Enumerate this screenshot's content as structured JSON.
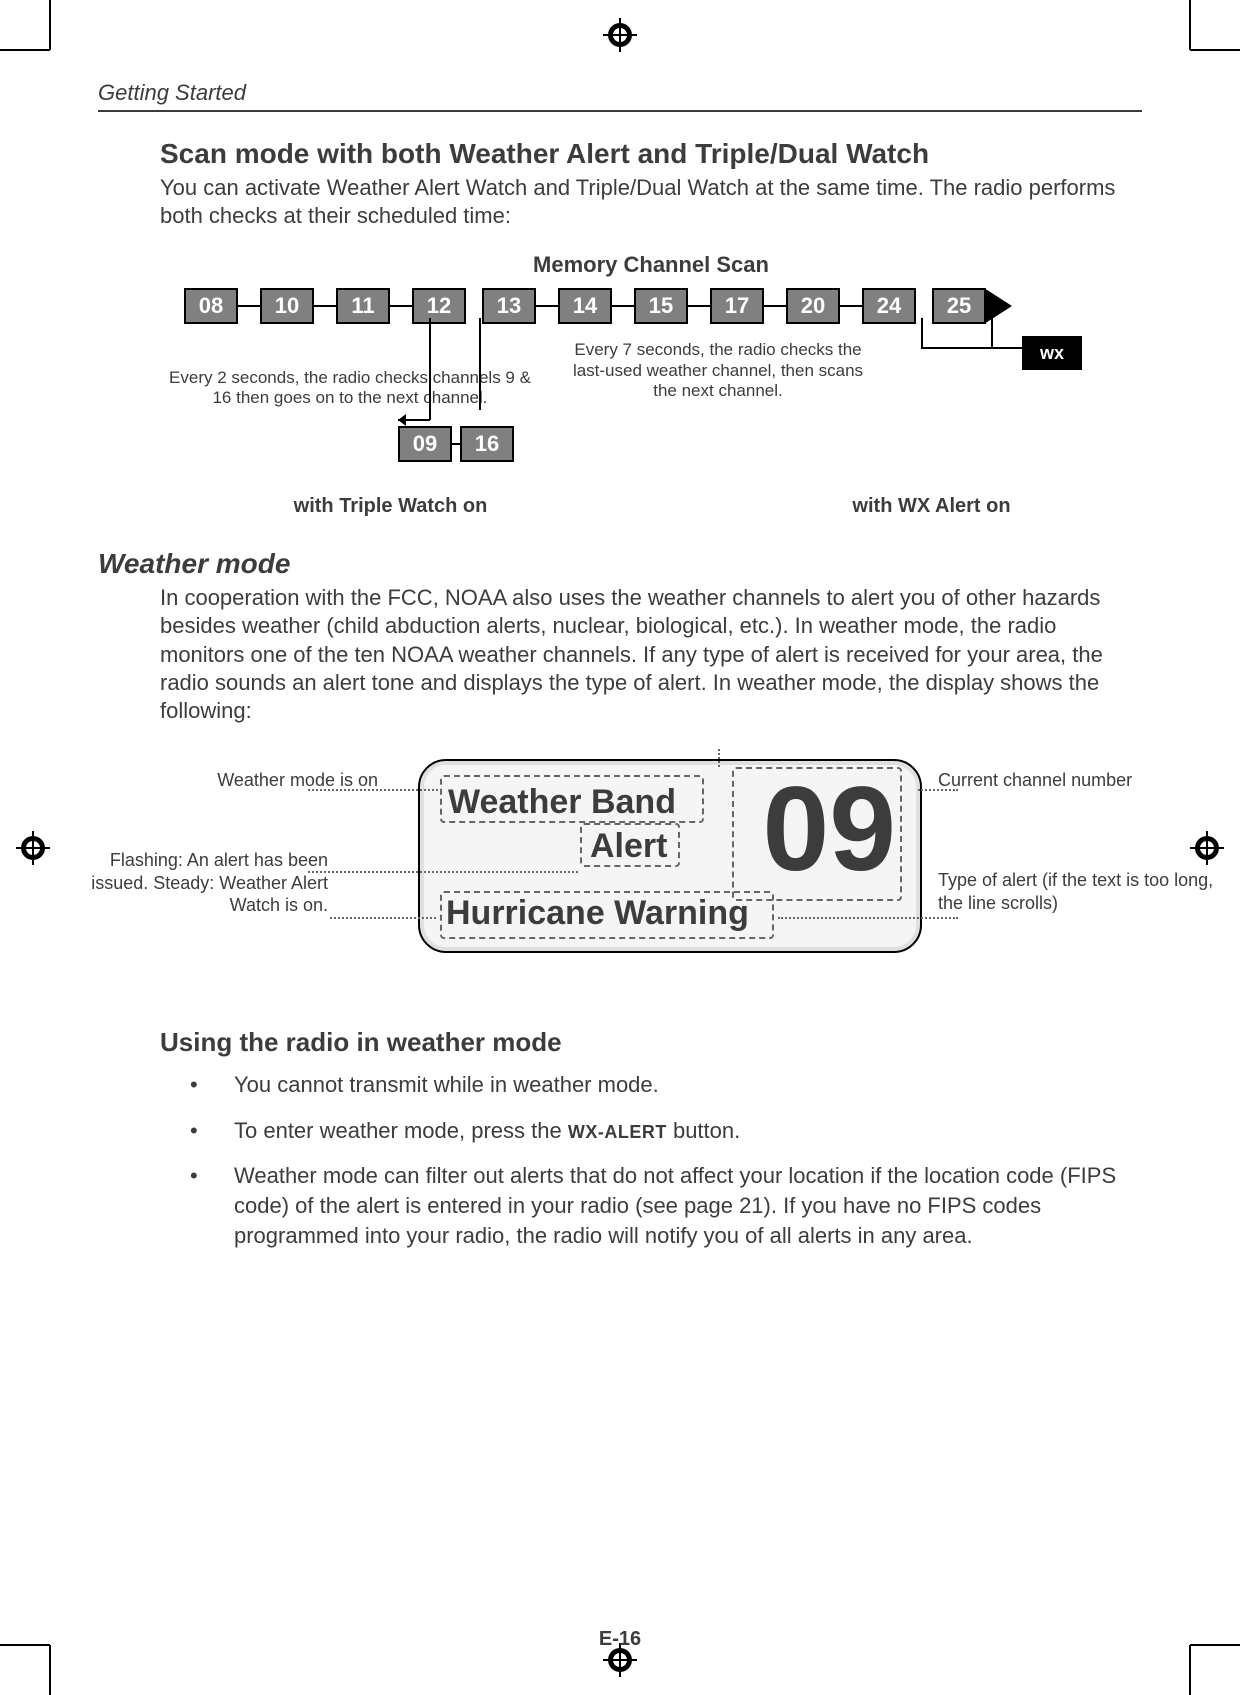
{
  "running_head": "Getting Started",
  "section1_title": "Scan mode with both Weather Alert and Triple/Dual Watch",
  "section1_body": "You can activate Weather Alert Watch and Triple/Dual Watch at the same time. The radio performs both checks at their scheduled time:",
  "diagram": {
    "title": "Memory Channel Scan",
    "channels": [
      "08",
      "10",
      "11",
      "12",
      "13",
      "14",
      "15",
      "17",
      "20",
      "24",
      "25"
    ],
    "pair": [
      "09",
      "16"
    ],
    "wx": "wx",
    "left_desc": "Every 2 seconds, the radio checks channels 9 & 16 then goes on to the next channel.",
    "right_desc": "Every 7 seconds, the radio checks the last-used weather channel, then scans the next channel.",
    "caption_left": "with Triple Watch on",
    "caption_right": "with WX Alert on"
  },
  "weather_mode": {
    "heading": "Weather mode",
    "body": "In cooperation with the FCC, NOAA also uses the weather channels to alert you of other hazards besides weather (child abduction alerts, nuclear, biological, etc.). In weather mode, the radio monitors one of the ten NOAA weather channels. If any type of alert is received for your area, the radio sounds an alert tone and displays the type of alert. In weather mode, the display shows the following:",
    "lcd": {
      "band": "Weather Band",
      "alert": "Alert",
      "channel": "09",
      "line2": "Hurricane Warning"
    },
    "callouts": {
      "left_top": "Weather mode is on",
      "left_bottom": "Flashing: An alert has been issued. Steady: Weather Alert Watch is on.",
      "right_top": "Current channel number",
      "right_bottom": "Type of alert (if the text is too long, the line scrolls)"
    }
  },
  "using": {
    "heading": "Using the radio in weather mode",
    "items": [
      "You cannot transmit while in weather mode.",
      "To enter weather mode, press the |WX-ALERT| button.",
      "Weather mode can filter out alerts that do not affect your location if the location code (FIPS code) of the alert is entered in your radio (see page 21). If you have no FIPS codes programmed into your radio, the radio will notify you of all alerts in any area."
    ]
  },
  "folio": "E-16"
}
